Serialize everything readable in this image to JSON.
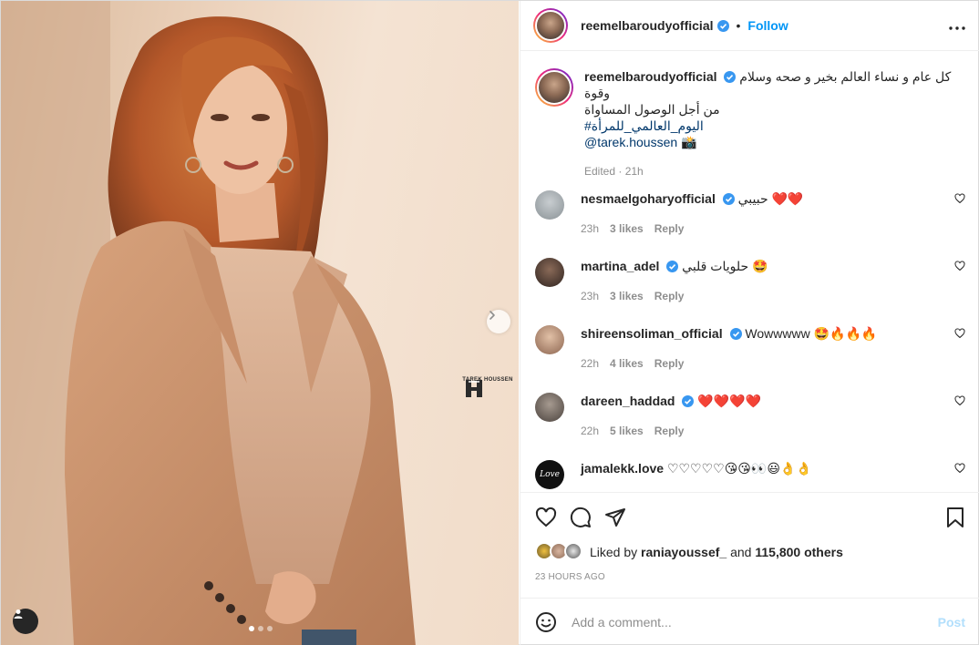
{
  "post": {
    "author": "reemelbaroudyofficial",
    "follow_label": "Follow",
    "separator": "•",
    "watermark": "TAREK HOUSSEN",
    "carousel": {
      "total": 3,
      "active": 1
    }
  },
  "caption": {
    "username": "reemelbaroudyofficial",
    "line1": "كل عام و نساء العالم بخير و صحه وسلام وقوة",
    "line2": "من أجل الوصول المساواة",
    "hashtag": "#اليوم_العالمي_للمرأة",
    "mention": "@tarek.houssen",
    "mention_emoji": "📸",
    "meta": "Edited · 21h"
  },
  "comments": [
    {
      "username": "nesmaelgoharyofficial",
      "verified": true,
      "text": "حبيبي ❤️❤️",
      "time": "23h",
      "likes": "3 likes",
      "reply": "Reply",
      "avatar_color": "#9aa3a8"
    },
    {
      "username": "martina_adel",
      "verified": true,
      "text": "حلويات قلبي 🤩",
      "time": "23h",
      "likes": "3 likes",
      "reply": "Reply",
      "avatar_color": "#4a3a33"
    },
    {
      "username": "shireensoliman_official",
      "verified": true,
      "text": "Wowwwww 🤩🔥🔥🔥",
      "time": "22h",
      "likes": "4 likes",
      "reply": "Reply",
      "avatar_color": "#a5806d"
    },
    {
      "username": "dareen_haddad",
      "verified": true,
      "text": "❤️❤️❤️❤️",
      "time": "22h",
      "likes": "5 likes",
      "reply": "Reply",
      "avatar_color": "#6f655e"
    },
    {
      "username": "jamalekk.love",
      "verified": false,
      "text": "♡♡♡♡♡😘😘👀😃👌👌",
      "time": "",
      "likes": "",
      "reply": "",
      "avatar_color": "#111111",
      "avatar_text": "Love"
    }
  ],
  "likes": {
    "prefix": "Liked by",
    "user": "raniayoussef_",
    "middle": "and",
    "count": "115,800 others"
  },
  "timestamp": "23 HOURS AGO",
  "add_comment": {
    "placeholder": "Add a comment...",
    "post_label": "Post"
  },
  "colors": {
    "accent": "#0095f6",
    "link": "#00376b",
    "muted": "#8e8e8e",
    "heart_red": "#ed4956"
  },
  "icons": [
    "verified-icon",
    "more-icon",
    "heart-icon",
    "comment-icon",
    "share-icon",
    "save-icon",
    "emoji-icon",
    "user-tag-icon",
    "chevron-right-icon"
  ]
}
